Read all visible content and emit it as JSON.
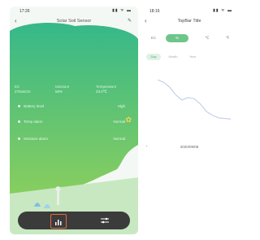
{
  "left": {
    "status": {
      "time": "17:26",
      "icons": "▮▮ ᯤ ▬"
    },
    "header": {
      "back": "‹",
      "title": "Solar Soil Sensor",
      "edit": "✎"
    },
    "metrics": [
      {
        "label": "EC",
        "value": "270us/cm"
      },
      {
        "label": "Moisture",
        "value": "56%"
      },
      {
        "label": "Temperature",
        "value": "23.0℃"
      }
    ],
    "rows": [
      {
        "label": "Battery level",
        "value": "High"
      },
      {
        "label": "Temp alarm",
        "value": "Normal"
      },
      {
        "label": "Moisture alarm",
        "value": "Normal"
      }
    ],
    "colors": {
      "green": "#3fbf85",
      "teal": "#2e9e8e",
      "bar": "#3b3b3b",
      "accent": "#e06b3a"
    }
  },
  "right": {
    "status": {
      "time": "18:16",
      "icons": "▮▮ ᯤ ▬"
    },
    "header": {
      "back": "‹",
      "title": "TopBar Title"
    },
    "unit_tabs": [
      "EC",
      "%",
      "℃",
      "℉"
    ],
    "active_unit": 1,
    "range_tabs": [
      "Day",
      "Month",
      "Year"
    ],
    "active_range": 0,
    "date": "2020/09/08",
    "prev": "‹",
    "colors": {
      "accent": "#6ec58a",
      "line": "#b9c9e6"
    }
  },
  "chart_data": {
    "type": "line",
    "x": [
      0,
      1,
      2,
      3,
      4,
      5,
      6,
      7,
      8,
      9,
      10,
      11,
      12
    ],
    "values": [
      82,
      78,
      70,
      58,
      50,
      54,
      52,
      44,
      32,
      26,
      22,
      21,
      20
    ],
    "ylim": [
      0,
      100
    ]
  }
}
